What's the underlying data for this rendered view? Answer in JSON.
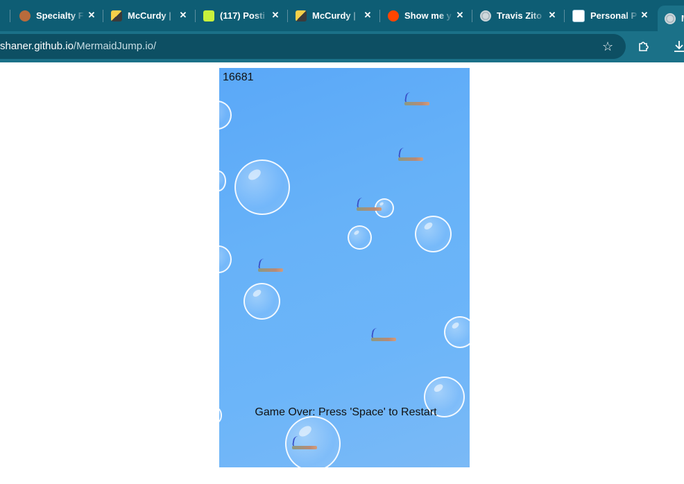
{
  "browser": {
    "tabs": [
      {
        "title": "Specialty F",
        "favicon": "pie-favicon",
        "color": "#a0522d"
      },
      {
        "title": "McCurdy |",
        "favicon": "mccurdy-favicon",
        "color": "#d4a017"
      },
      {
        "title": "(117) Posti",
        "favicon": "posting-favicon",
        "color": "#c8f03c"
      },
      {
        "title": "McCurdy |",
        "favicon": "mccurdy-favicon",
        "color": "#d4a017"
      },
      {
        "title": "Show me y",
        "favicon": "reddit-favicon",
        "color": "#ff4500"
      },
      {
        "title": "Travis Zito",
        "favicon": "globe-favicon",
        "color": "#cfd8dc"
      },
      {
        "title": "Personal P",
        "favicon": "doc-favicon",
        "color": "#ffffff"
      },
      {
        "title": "M",
        "favicon": "globe-favicon",
        "color": "#cfd8dc"
      }
    ],
    "close_glyph": "✕",
    "url_host": "shaner.github.io",
    "url_path": "/MermaidJump.io/",
    "bookmark_icon": "star-icon",
    "extensions_icon": "puzzle-icon",
    "download_icon": "download-icon"
  },
  "game": {
    "score": "16681",
    "game_over_text": "Game Over: Press 'Space' to Restart"
  }
}
